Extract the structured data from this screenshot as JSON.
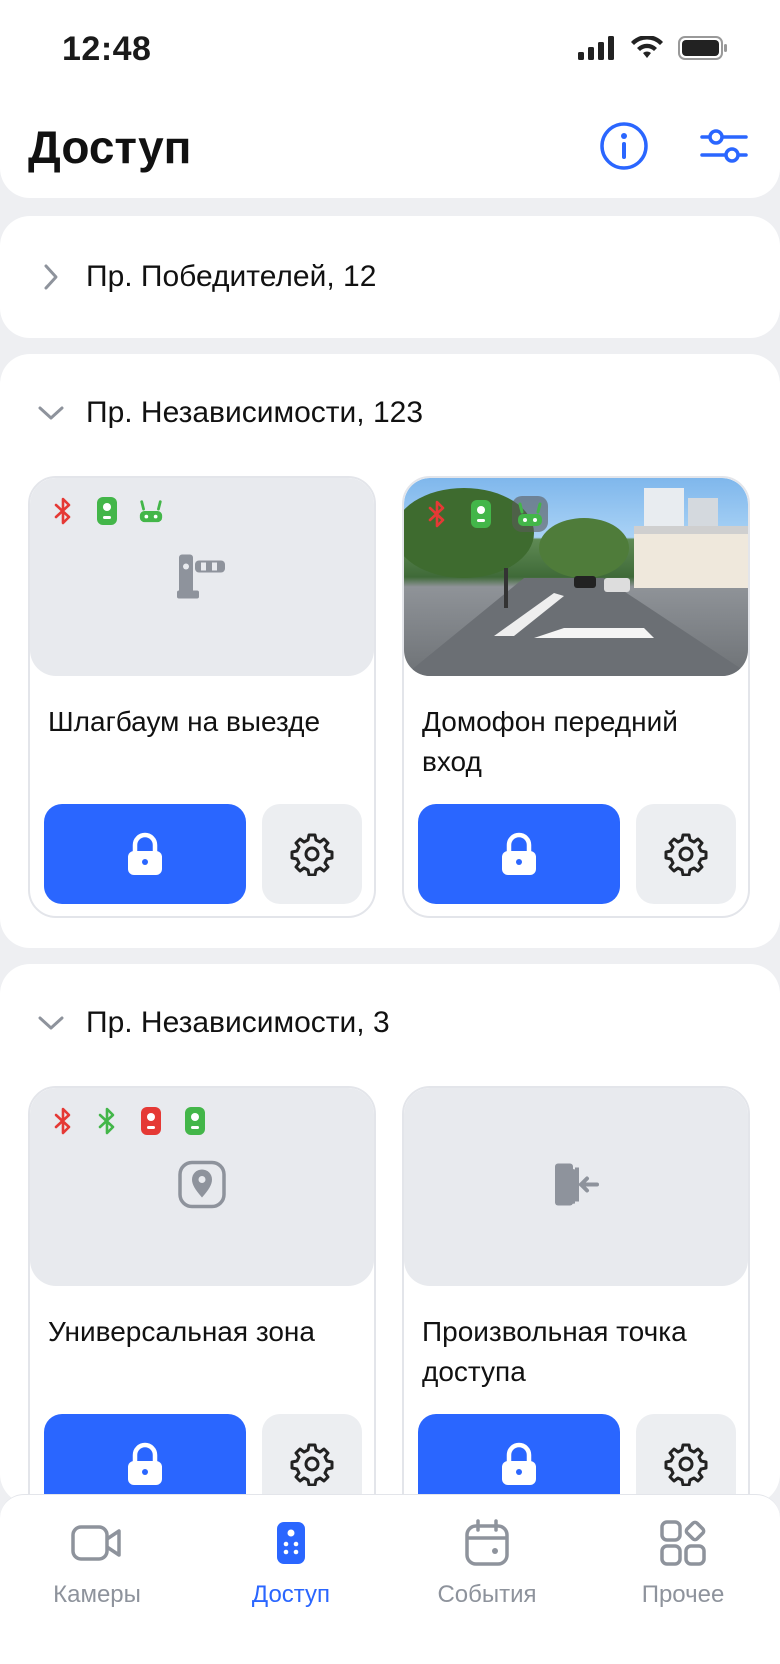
{
  "status": {
    "time": "12:48"
  },
  "header": {
    "title": "Доступ"
  },
  "groups": [
    {
      "title": "Пр. Победителей, 12",
      "expanded": false
    },
    {
      "title": "Пр. Независимости, 123",
      "expanded": true,
      "cards": [
        {
          "name": "Шлагбаум на выезде",
          "icon": "barrier-icon",
          "badges": [
            "bluetooth-red",
            "intercom-green",
            "router-green"
          ]
        },
        {
          "name": "Домофон передний вход",
          "icon": "camera-preview",
          "badges": [
            "bluetooth-red",
            "intercom-green",
            "router-green"
          ]
        }
      ]
    },
    {
      "title": "Пр. Независимости, 3",
      "expanded": true,
      "cards": [
        {
          "name": "Универсальная зона",
          "icon": "location-pin-icon",
          "badges": [
            "bluetooth-red",
            "bluetooth-green",
            "intercom-red",
            "intercom-green"
          ]
        },
        {
          "name": "Произвольная точка доступа",
          "icon": "door-enter-icon",
          "badges": []
        }
      ]
    }
  ],
  "tabs": [
    {
      "label": "Камеры",
      "icon": "video-camera-icon",
      "active": false
    },
    {
      "label": "Доступ",
      "icon": "remote-icon",
      "active": true
    },
    {
      "label": "События",
      "icon": "calendar-icon",
      "active": false
    },
    {
      "label": "Прочее",
      "icon": "apps-icon",
      "active": false
    }
  ],
  "colors": {
    "accent": "#2a66ff",
    "red": "#e53935",
    "green": "#43b649",
    "muted": "#8e939c"
  }
}
